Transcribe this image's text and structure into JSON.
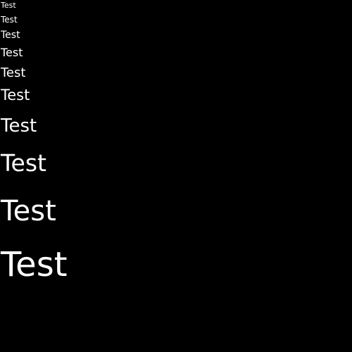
{
  "background_color": "#000000",
  "text_color": "#ffffff",
  "samples": [
    {
      "text": "Test"
    },
    {
      "text": "Test"
    },
    {
      "text": "Test"
    },
    {
      "text": "Test"
    },
    {
      "text": "Test"
    },
    {
      "text": "Test"
    },
    {
      "text": "Test"
    },
    {
      "text": "Test"
    },
    {
      "text": "Test"
    },
    {
      "text": "Test"
    }
  ]
}
